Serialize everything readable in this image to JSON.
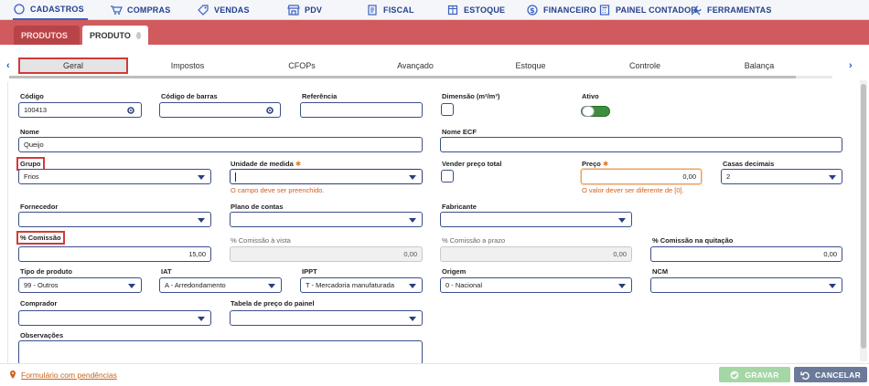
{
  "nav": {
    "items": [
      {
        "label": "CADASTROS",
        "icon": "circle-icon"
      },
      {
        "label": "COMPRAS",
        "icon": "cart-icon"
      },
      {
        "label": "VENDAS",
        "icon": "tag-icon"
      },
      {
        "label": "PDV",
        "icon": "store-icon"
      },
      {
        "label": "FISCAL",
        "icon": "document-icon"
      },
      {
        "label": "ESTOQUE",
        "icon": "box-icon"
      },
      {
        "label": "FINANCEIRO",
        "icon": "dollar-icon"
      },
      {
        "label": "PAINEL CONTADOR",
        "icon": "calculator-icon"
      },
      {
        "label": "FERRAMENTAS",
        "icon": "tools-icon"
      }
    ]
  },
  "page_tabs": [
    {
      "label": "PRODUTOS"
    },
    {
      "label": "PRODUTO"
    }
  ],
  "inner_tabs": [
    "Geral",
    "Impostos",
    "CFOPs",
    "Avançado",
    "Estoque",
    "Controle",
    "Balança"
  ],
  "form": {
    "codigo": {
      "label": "Código",
      "value": "100413"
    },
    "codigo_barras": {
      "label": "Código de barras",
      "value": ""
    },
    "referencia": {
      "label": "Referência",
      "value": ""
    },
    "dimensao": {
      "label": "Dimensão (m²/m³)"
    },
    "ativo": {
      "label": "Ativo",
      "on": true
    },
    "nome": {
      "label": "Nome",
      "value": "Queijo"
    },
    "nome_ecf": {
      "label": "Nome ECF",
      "value": ""
    },
    "grupo": {
      "label": "Grupo",
      "value": "Frios"
    },
    "unidade": {
      "label": "Unidade de medida",
      "required": "✱",
      "value": "",
      "error": "O campo deve ser preenchido."
    },
    "vender_preco_total": {
      "label": "Vender preço total"
    },
    "preco": {
      "label": "Preço",
      "required": "✱",
      "value": "0,00",
      "error": "O valor dever ser diferente de [0]."
    },
    "casas_decimais": {
      "label": "Casas decimais",
      "value": "2"
    },
    "fornecedor": {
      "label": "Fornecedor",
      "value": ""
    },
    "plano_contas": {
      "label": "Plano de contas",
      "value": ""
    },
    "fabricante": {
      "label": "Fabricante",
      "value": ""
    },
    "comissao": {
      "label": "% Comissão",
      "value": "15,00"
    },
    "comissao_vista": {
      "label": "% Comissão à vista",
      "value": "0,00"
    },
    "comissao_prazo": {
      "label": "% Comissão a prazo",
      "value": "0,00"
    },
    "comissao_quitacao": {
      "label": "% Comissão na quitação",
      "value": "0,00"
    },
    "tipo_produto": {
      "label": "Tipo de produto",
      "value": "99 - Outros"
    },
    "iat": {
      "label": "IAT",
      "value": "A - Arredondamento"
    },
    "ippt": {
      "label": "IPPT",
      "value": "T - Mercadoria manufaturada"
    },
    "origem": {
      "label": "Origem",
      "value": "0 - Nacional"
    },
    "ncm": {
      "label": "NCM",
      "value": ""
    },
    "comprador": {
      "label": "Comprador",
      "value": ""
    },
    "tabela_preco": {
      "label": "Tabela de preço do painel",
      "value": ""
    },
    "observacoes": {
      "label": "Observações",
      "value": ""
    }
  },
  "footer": {
    "pendencias": "Formulário com pendências",
    "save_label": "GRAVAR",
    "cancel_label": "CANCELAR"
  },
  "colors": {
    "brand_red": "#d05a5e",
    "nav_blue": "#25408f",
    "error_orange": "#d45f1e",
    "toggle_green": "#3c8f3c"
  }
}
